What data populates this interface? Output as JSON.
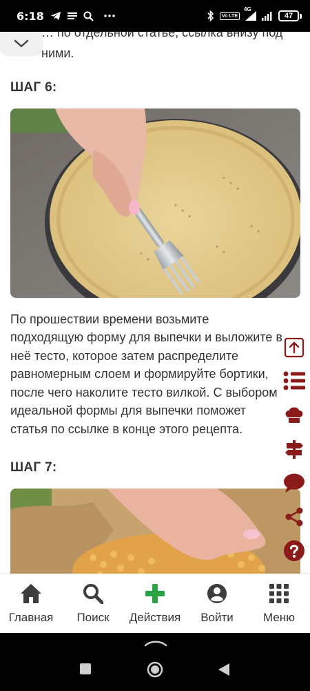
{
  "status_bar": {
    "time": "6:18",
    "network": "4G",
    "volte": "Vo LTE",
    "battery": "47",
    "icons": [
      "telegram-icon",
      "notes-icon",
      "search-icon",
      "more-icon",
      "bluetooth-icon",
      "volte-icon",
      "signal-icon",
      "wifi-icon",
      "battery-icon"
    ]
  },
  "article": {
    "top_text": "… по отдельной статье, ссылка внизу под ними.",
    "step6": {
      "title": "ШАГ 6:",
      "lines": [
        "По прошествии времени возьмите",
        "подходящую форму для выпечки и выложите в",
        "неё тесто, которое затем распределите",
        "равномерным слоем и формируйте бортики,",
        "после чего наколите тесто вилкой. С выбором",
        "идеальной формы для выпечки поможет",
        "статья по ссылке в конце этого рецепта."
      ]
    },
    "step7": {
      "title": "ШАГ 7:"
    }
  },
  "side_tools": [
    "scroll-up-icon",
    "list-icon",
    "chef-hat-icon",
    "signpost-icon",
    "comment-icon",
    "share-icon",
    "help-icon",
    "close-icon"
  ],
  "bottom_nav": {
    "home": "Главная",
    "search": "Поиск",
    "actions": "Действия",
    "login": "Войти",
    "menu": "Меню"
  },
  "colors": {
    "accent": "#8b1a1a",
    "action_green": "#27a344",
    "icon_dark": "#3d3d3d"
  }
}
